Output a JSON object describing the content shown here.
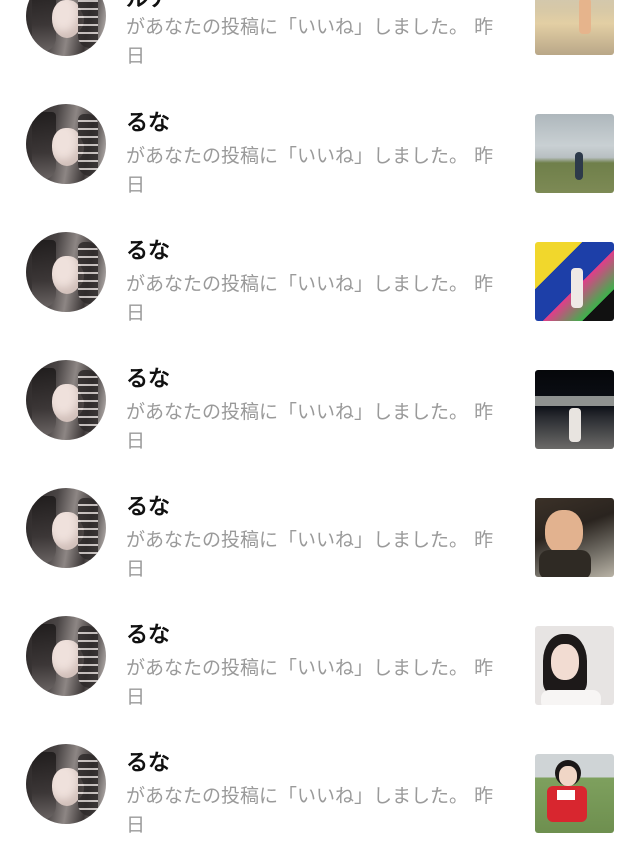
{
  "notifications": [
    {
      "name": "ルナ",
      "message": "があなたの投稿に「いいね」しました。",
      "time": "昨日",
      "thumb": "beach-sunset"
    },
    {
      "name": "るな",
      "message": "があなたの投稿に「いいね」しました。",
      "time": "昨日",
      "thumb": "field-sky"
    },
    {
      "name": "るな",
      "message": "があなたの投稿に「いいね」しました。",
      "time": "昨日",
      "thumb": "colorful-wall"
    },
    {
      "name": "るな",
      "message": "があなたの投稿に「いいね」しました。",
      "time": "昨日",
      "thumb": "night-structure"
    },
    {
      "name": "るな",
      "message": "があなたの投稿に「いいね」しました。",
      "time": "昨日",
      "thumb": "street-smile"
    },
    {
      "name": "るな",
      "message": "があなたの投稿に「いいね」しました。",
      "time": "昨日",
      "thumb": "portrait-peace"
    },
    {
      "name": "るな",
      "message": "があなたの投稿に「いいね」しました。",
      "time": "昨日",
      "thumb": "sports-jersey"
    }
  ]
}
